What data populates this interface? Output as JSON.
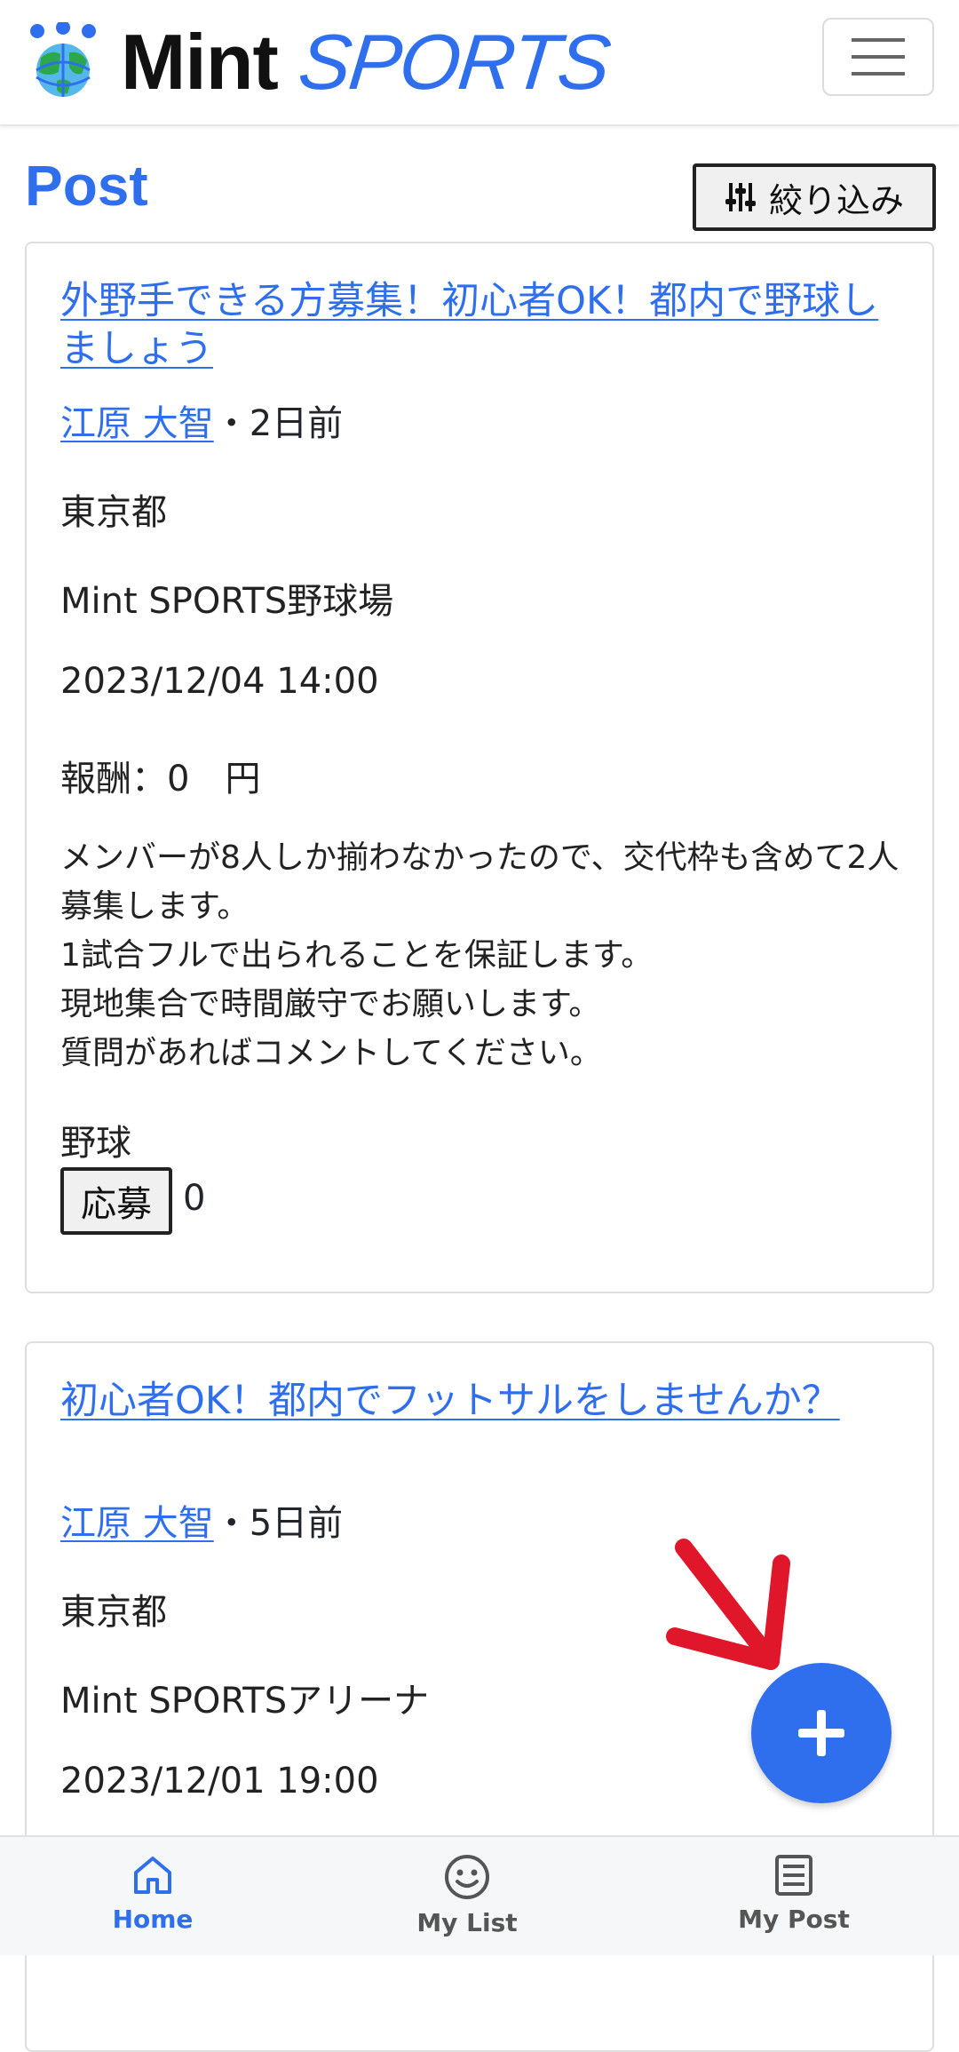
{
  "header": {
    "brand_mint": "Mint",
    "brand_sports": "SPORTS"
  },
  "page": {
    "title": "Post",
    "filter_label": "絞り込み"
  },
  "posts": [
    {
      "title": "外野手できる方募集！初心者OK！都内で野球しましょう",
      "author": "江原 大智",
      "time_ago": "・2日前",
      "prefecture": "東京都",
      "venue": "Mint SPORTS野球場",
      "datetime": "2023/12/04 14:00",
      "reward": "報酬：0　円",
      "description": [
        "メンバーが8人しか揃わなかったので、交代枠も含めて2人募集します。",
        "1試合フルで出られることを保証します。",
        "現地集合で時間厳守でお願いします。",
        "質問があればコメントしてください。"
      ],
      "sport": "野球",
      "apply_label": "応募",
      "apply_count": "0"
    },
    {
      "title": "初心者OK！都内でフットサルをしませんか？",
      "author": "江原 大智",
      "time_ago": "・5日前",
      "prefecture": "東京都",
      "venue": "Mint SPORTSアリーナ",
      "datetime": "2023/12/01 19:00"
    }
  ],
  "nav": {
    "home": "Home",
    "my_list": "My List",
    "my_post": "My Post"
  },
  "colors": {
    "accent": "#2f6fed",
    "arrow": "#e0162b"
  }
}
